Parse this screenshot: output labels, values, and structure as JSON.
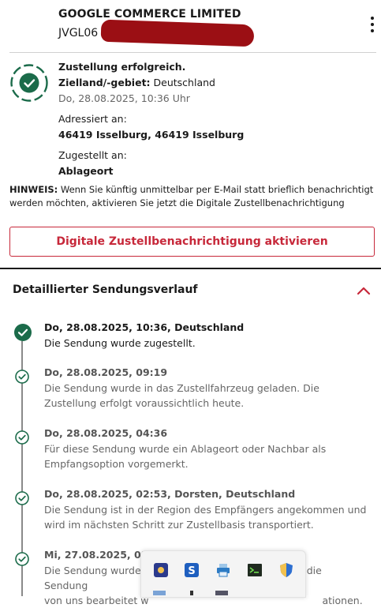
{
  "header": {
    "sender": "GOOGLE COMMERCE LIMITED",
    "tracking_number": "JVGL06",
    "menu_icon": "kebab-menu-icon"
  },
  "status": {
    "icon": "check-circle-icon",
    "color": "#1b6b4a",
    "title": "Zustellung erfolgreich.",
    "destination_label": "Zielland/-gebiet:",
    "destination_value": "Deutschland",
    "datetime": "Do, 28.08.2025, 10:36 Uhr",
    "addressed_label": "Adressiert an:",
    "addressed_value": "46419 Isselburg, 46419 Isselburg",
    "delivered_label": "Zugestellt an:",
    "delivered_value": "Ablageort"
  },
  "hint": {
    "label": "HINWEIS:",
    "text": "Wenn Sie künftig unmittelbar per E-Mail statt brieflich benachrichtigt werden möchten, aktivieren Sie jetzt die Digitale Zustellbenachrichtigung"
  },
  "cta": {
    "label": "Digitale Zustellbenachrichtigung aktivieren",
    "color": "#c7283a"
  },
  "history": {
    "title": "Detaillierter Sendungsverlauf",
    "toggle_icon": "chevron-up-icon",
    "events": [
      {
        "title": "Do, 28.08.2025, 10:36, Deutschland",
        "desc": "Die Sendung wurde zugestellt."
      },
      {
        "title": "Do, 28.08.2025, 09:19",
        "desc": "Die Sendung wurde in das Zustellfahrzeug geladen. Die Zustellung erfolgt voraussichtlich heute."
      },
      {
        "title": "Do, 28.08.2025, 04:36",
        "desc": "Für diese Sendung wurde ein Ablageort oder Nachbar als Empfangsoption vorgemerkt."
      },
      {
        "title": "Do, 28.08.2025, 02:53, Dorsten, Deutschland",
        "desc": "Die Sendung ist in der Region des Empfängers angekommen und wird im nächsten Schritt zur Zustellbasis transportiert."
      },
      {
        "title": "Mi, 27.08.2025, 05:",
        "desc_part1": "Die Sendung wurde",
        "desc_part1b": "die Sendung",
        "desc_part2": "von uns bearbeitet w",
        "desc_part2b": "ationen."
      }
    ]
  },
  "taskbar": {
    "icons": [
      "app-icon-blue",
      "s-app-icon",
      "printer-icon",
      "terminal-icon",
      "shield-icon"
    ]
  }
}
